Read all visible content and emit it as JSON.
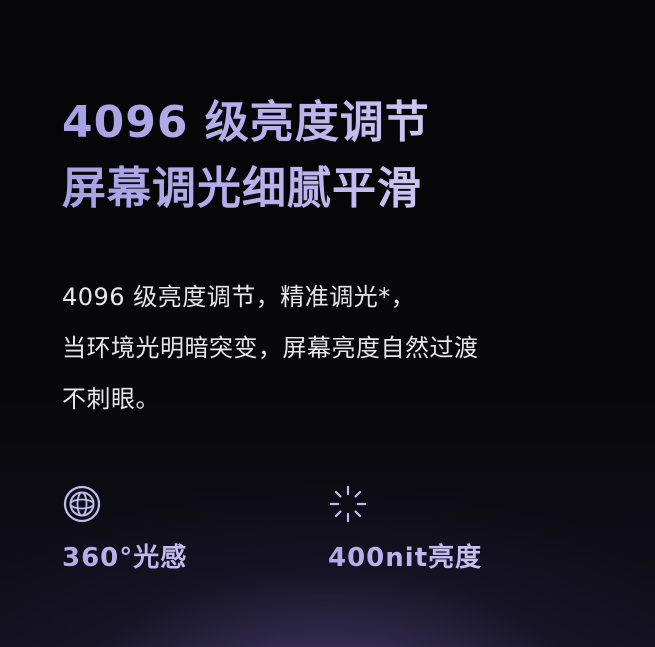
{
  "headline": {
    "line1": "4096 级亮度调节",
    "line2": "屏幕调光细腻平滑"
  },
  "body": {
    "line1": "4096 级亮度调节，精准调光*，",
    "line2": "当环境光明暗突变，屏幕亮度自然过渡",
    "line3": "不刺眼。"
  },
  "features": [
    {
      "icon": "orbit-sensor-icon",
      "label": "360°光感"
    },
    {
      "icon": "brightness-icon",
      "label": "400nit亮度"
    }
  ],
  "colors": {
    "background": "#070709",
    "accent": "#b2a8ea",
    "body_text": "#e7e7ea"
  }
}
